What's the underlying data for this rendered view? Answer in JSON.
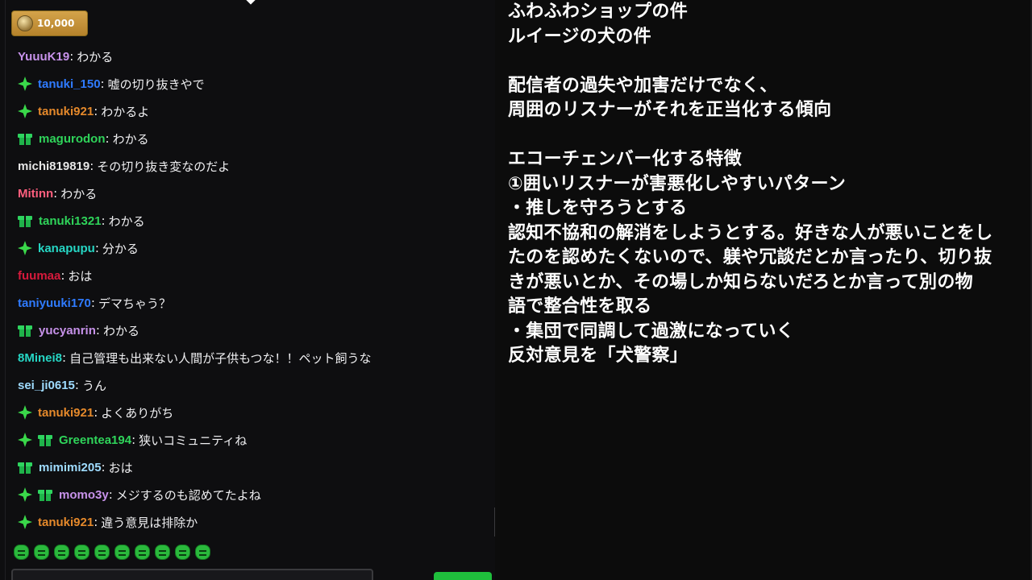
{
  "chat": {
    "points": "10,000",
    "messages": [
      {
        "user": "YuuuK19",
        "color": "#c792ea",
        "badges": [],
        "text": "わかる"
      },
      {
        "user": "tanuki_150",
        "color": "#2f7bff",
        "badges": [
          "prime"
        ],
        "text": "嘘の切り抜きやで"
      },
      {
        "user": "tanuki921",
        "color": "#e5892b",
        "badges": [
          "prime"
        ],
        "text": "わかるよ"
      },
      {
        "user": "magurodon",
        "color": "#2fd45a",
        "badges": [
          "gift"
        ],
        "text": "わかる"
      },
      {
        "user": "michi819819",
        "color": "#e6e6e6",
        "badges": [],
        "text": "その切り抜き変なのだよ"
      },
      {
        "user": "Mitinn",
        "color": "#ff5f7e",
        "badges": [],
        "text": "わかる"
      },
      {
        "user": "tanuki1321",
        "color": "#2fd45a",
        "badges": [
          "gift"
        ],
        "text": "わかる"
      },
      {
        "user": "kanapupu",
        "color": "#26d6c4",
        "badges": [
          "prime"
        ],
        "text": "分かる"
      },
      {
        "user": "fuumaa",
        "color": "#d61a3c",
        "badges": [],
        "text": "おは"
      },
      {
        "user": "taniyuuki170",
        "color": "#2f7bff",
        "badges": [],
        "text": "デマちゃう？"
      },
      {
        "user": "yucyanrin",
        "color": "#c792ea",
        "badges": [
          "gift"
        ],
        "text": "わかる"
      },
      {
        "user": "8Minei8",
        "color": "#26d6c4",
        "badges": [],
        "text": "自己管理も出来ない人間が子供もつな！！ペット飼うな"
      },
      {
        "user": "sei_ji0615",
        "color": "#9fdcff",
        "badges": [],
        "text": "うん"
      },
      {
        "user": "tanuki921",
        "color": "#e5892b",
        "badges": [
          "prime"
        ],
        "text": "よくありがち"
      },
      {
        "user": "Greentea194",
        "color": "#2fd45a",
        "badges": [
          "prime",
          "gift"
        ],
        "text": "狭いコミュニティね"
      },
      {
        "user": "mimimi205",
        "color": "#9fdcff",
        "badges": [
          "gift"
        ],
        "text": "おは"
      },
      {
        "user": "momo3y",
        "color": "#c792ea",
        "badges": [
          "prime",
          "gift"
        ],
        "text": "メジするのも認めてたよね"
      },
      {
        "user": "tanuki921",
        "color": "#e5892b",
        "badges": [
          "prime"
        ],
        "text": "違う意見は排除か"
      }
    ],
    "emotes": [
      "emote-1",
      "emote-2",
      "emote-3",
      "emote-4",
      "emote-5",
      "emote-6",
      "emote-7",
      "emote-8",
      "emote-9",
      "emote-10"
    ]
  },
  "notes": {
    "lines": [
      "ふわふわショップの件",
      "ルイージの犬の件",
      "",
      "配信者の過失や加害だけでなく、",
      "周囲のリスナーがそれを正当化する傾向",
      "",
      "エコーチェンバー化する特徴",
      "①囲いリスナーが害悪化しやすいパターン",
      "・推しを守ろうとする",
      "認知不協和の解消をしようとする。好きな人が悪いことをし",
      "たのを認めたくないので、躾や冗談だとか言ったり、切り抜",
      "きが悪いとか、その場しか知らないだろとか言って別の物",
      "語で整合性を取る",
      "・集団で同調して過激になっていく",
      "反対意見を「犬警察」"
    ]
  }
}
